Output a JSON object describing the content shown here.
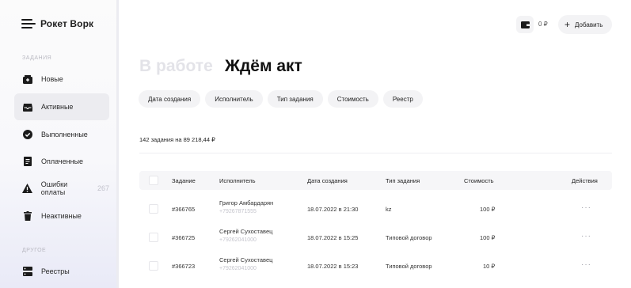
{
  "app": {
    "logo": "Рокет Ворк"
  },
  "sidebar": {
    "section_tasks": "ЗАДАНИЯ",
    "section_other": "ДРУГОЕ",
    "items": [
      {
        "label": "Новые",
        "icon": "inbox-new-icon"
      },
      {
        "label": "Активные",
        "icon": "inbox-active-icon",
        "active": true
      },
      {
        "label": "Выполненные",
        "icon": "check-circle-icon"
      },
      {
        "label": "Оплаченные",
        "icon": "receipt-icon"
      },
      {
        "label": "Ошибки оплаты",
        "icon": "warning-icon",
        "count": "267"
      },
      {
        "label": "Неактивные",
        "icon": "trash-icon"
      },
      {
        "label": "Реестры",
        "icon": "registry-icon"
      }
    ]
  },
  "header": {
    "balance": "0 ₽",
    "add_label": "Добавить"
  },
  "page": {
    "title_inactive": "В работе",
    "title_active": "Ждём акт"
  },
  "filters": [
    "Дата создания",
    "Исполнитель",
    "Тип задания",
    "Стоимость",
    "Реестр"
  ],
  "summary": "142 задания на 89 218,44 ₽",
  "table": {
    "columns": [
      "Задание",
      "Исполнитель",
      "Дата создания",
      "Тип задания",
      "Стоимость",
      "Действия"
    ],
    "rows": [
      {
        "id": "#366765",
        "name": "Григор Амбардарян",
        "phone": "+79267871555",
        "date": "18.07.2022 в 21:30",
        "type": "kz",
        "cost": "100 ₽"
      },
      {
        "id": "#366725",
        "name": "Сергей Сухоставец",
        "phone": "+79262041000",
        "date": "18.07.2022 в 15:25",
        "type": "Типовой договор",
        "cost": "100 ₽"
      },
      {
        "id": "#366723",
        "name": "Сергей Сухоставец",
        "phone": "+79262041000",
        "date": "18.07.2022 в 15:23",
        "type": "Типовой договор",
        "cost": "10 ₽"
      }
    ],
    "actions_symbol": "···"
  },
  "colors": {
    "accent_bg": "#e9eaf7",
    "chip_bg": "#f3f3f5",
    "muted_text": "#c4c4cc"
  }
}
